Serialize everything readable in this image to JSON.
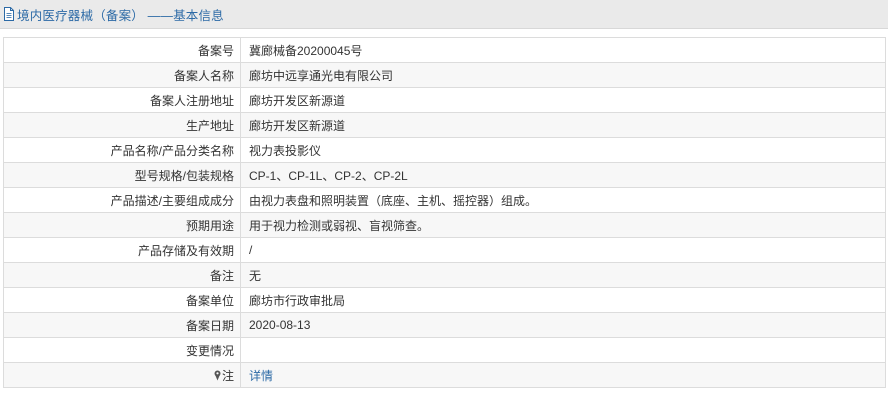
{
  "header": {
    "title": "境内医疗器械（备案） ——基本信息",
    "icon": "document-icon",
    "accent_color": "#2c6aa6"
  },
  "rows": [
    {
      "label": "备案号",
      "value": "冀廊械备20200045号"
    },
    {
      "label": "备案人名称",
      "value": "廊坊中远享通光电有限公司"
    },
    {
      "label": "备案人注册地址",
      "value": "廊坊开发区新源道"
    },
    {
      "label": "生产地址",
      "value": "廊坊开发区新源道"
    },
    {
      "label": "产品名称/产品分类名称",
      "value": "视力表投影仪"
    },
    {
      "label": "型号规格/包装规格",
      "value": "CP-1、CP-1L、CP-2、CP-2L"
    },
    {
      "label": "产品描述/主要组成成分",
      "value": "由视力表盘和照明装置（底座、主机、摇控器）组成。"
    },
    {
      "label": "预期用途",
      "value": "用于视力检测或弱视、盲视筛查。"
    },
    {
      "label": "产品存储及有效期",
      "value": "/"
    },
    {
      "label": "备注",
      "value": "无"
    },
    {
      "label": "备案单位",
      "value": "廊坊市行政审批局"
    },
    {
      "label": "备案日期",
      "value": "2020-08-13"
    },
    {
      "label": "变更情况",
      "value": ""
    }
  ],
  "note_row": {
    "label": "注",
    "icon": "pin-icon",
    "link_text": "详情",
    "link_color": "#2c6aa6"
  }
}
